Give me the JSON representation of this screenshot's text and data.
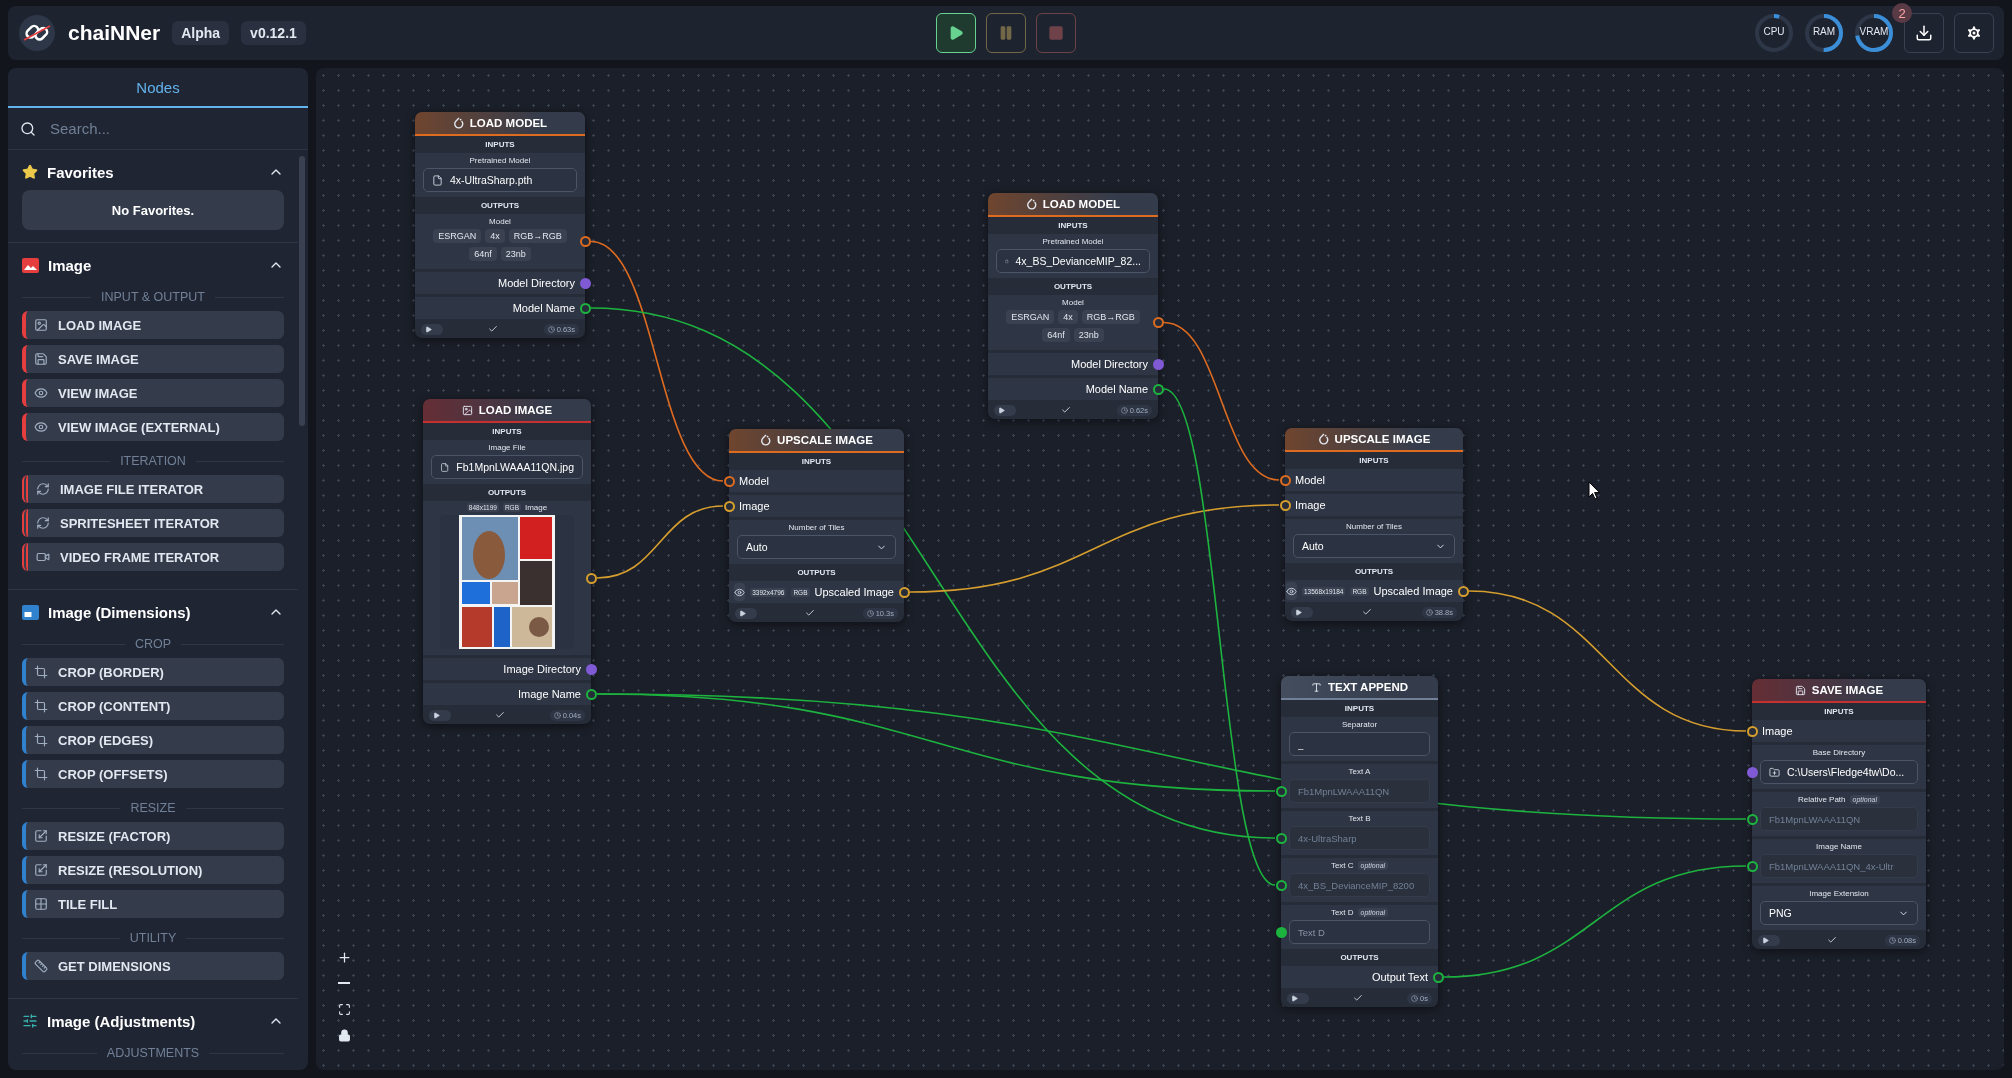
{
  "header": {
    "app_name": "chaiNNer",
    "badges": [
      "Alpha",
      "v0.12.1"
    ],
    "controls": [
      {
        "kind": "play",
        "disabled": false
      },
      {
        "kind": "pause",
        "disabled": true
      },
      {
        "kind": "stop",
        "disabled": true
      }
    ],
    "monitors": [
      {
        "label": "CPU"
      },
      {
        "label": "RAM"
      },
      {
        "label": "VRAM"
      }
    ],
    "download_count": "2"
  },
  "sidebar": {
    "tabs": [
      {
        "label": "Nodes",
        "selected": true
      }
    ],
    "search": {
      "placeholder": "Search..."
    },
    "categories": [
      {
        "name": "Favorites",
        "color": "#ecc94b",
        "expanded": true,
        "empty_text": "No Favorites."
      },
      {
        "name": "Image",
        "color": "#e53e3e",
        "expanded": true,
        "groups": [
          {
            "label": "INPUT & OUTPUT",
            "items": [
              {
                "label": "LOAD IMAGE",
                "kind": "node"
              },
              {
                "label": "SAVE IMAGE",
                "kind": "node"
              },
              {
                "label": "VIEW IMAGE",
                "kind": "node"
              },
              {
                "label": "VIEW IMAGE (EXTERNAL)",
                "kind": "node"
              }
            ]
          },
          {
            "label": "ITERATION",
            "items": [
              {
                "label": "IMAGE FILE ITERATOR",
                "kind": "iterator"
              },
              {
                "label": "SPRITESHEET ITERATOR",
                "kind": "iterator"
              },
              {
                "label": "VIDEO FRAME ITERATOR",
                "kind": "iterator"
              }
            ]
          }
        ]
      },
      {
        "name": "Image (Dimensions)",
        "color": "#3182ce",
        "expanded": true,
        "groups": [
          {
            "label": "CROP",
            "items": [
              {
                "label": "CROP (BORDER)",
                "kind": "node"
              },
              {
                "label": "CROP (CONTENT)",
                "kind": "node"
              },
              {
                "label": "CROP (EDGES)",
                "kind": "node"
              },
              {
                "label": "CROP (OFFSETS)",
                "kind": "node"
              }
            ]
          },
          {
            "label": "RESIZE",
            "items": [
              {
                "label": "RESIZE (FACTOR)",
                "kind": "node"
              },
              {
                "label": "RESIZE (RESOLUTION)",
                "kind": "node"
              },
              {
                "label": "TILE FILL",
                "kind": "node"
              }
            ]
          },
          {
            "label": "UTILITY",
            "items": [
              {
                "label": "GET DIMENSIONS",
                "kind": "node"
              }
            ]
          }
        ]
      },
      {
        "name": "Image (Adjustments)",
        "color": "#38b2ac",
        "expanded": true,
        "groups": [
          {
            "label": "ADJUSTMENTS"
          }
        ]
      }
    ]
  },
  "nodes": [
    {
      "title": "LOAD MODEL",
      "color": "#dd6b20",
      "enabled": true,
      "timing": "0.63s",
      "rows": [
        {
          "kind": "section",
          "label": "INPUTS"
        },
        {
          "kind": "file",
          "label": "Pretrained Model",
          "value": "4x-UltraSharp.pth"
        },
        {
          "kind": "section",
          "label": "OUTPUTS"
        },
        {
          "kind": "model_info",
          "label": "Model",
          "tags": [
            "ESRGAN",
            "4x",
            "RGB→RGB",
            "64nf",
            "23nb"
          ],
          "color": "#dd6b20",
          "connected": true
        },
        {
          "kind": "output",
          "label": "Model Directory",
          "color": "#805ad5",
          "connected": false
        },
        {
          "kind": "output",
          "label": "Model Name",
          "color": "#1db33f",
          "connected": true
        }
      ]
    },
    {
      "title": "LOAD IMAGE",
      "color": "#c53030",
      "enabled": true,
      "timing": "0.04s",
      "rows": [
        {
          "kind": "section",
          "label": "INPUTS"
        },
        {
          "kind": "file",
          "label": "Image File",
          "value": "Fb1MpnLWAAA11QN.jpg"
        },
        {
          "kind": "section",
          "label": "OUTPUTS"
        },
        {
          "kind": "image_preview",
          "tags": [
            "848x1199",
            "RGB"
          ],
          "label": "Image",
          "color": "#d69e2e",
          "connected": true
        },
        {
          "kind": "output",
          "label": "Image Directory",
          "color": "#805ad5",
          "connected": false
        },
        {
          "kind": "output",
          "label": "Image Name",
          "color": "#1db33f",
          "connected": true
        }
      ]
    },
    {
      "title": "UPSCALE IMAGE",
      "color": "#dd6b20",
      "enabled": true,
      "timing": "10.3s",
      "rows": [
        {
          "kind": "section",
          "label": "INPUTS"
        },
        {
          "kind": "input",
          "label": "Model",
          "color": "#dd6b20",
          "connected": true
        },
        {
          "kind": "input",
          "label": "Image",
          "color": "#d69e2e",
          "connected": true
        },
        {
          "kind": "select",
          "label": "Number of Tiles",
          "value": "Auto"
        },
        {
          "kind": "section",
          "label": "OUTPUTS"
        },
        {
          "kind": "output_image",
          "tags": [
            "3392x4796",
            "RGB"
          ],
          "label": "Upscaled Image",
          "color": "#d69e2e",
          "connected": true
        }
      ]
    },
    {
      "title": "LOAD MODEL",
      "color": "#dd6b20",
      "enabled": true,
      "timing": "0.62s",
      "rows": [
        {
          "kind": "section",
          "label": "INPUTS"
        },
        {
          "kind": "file",
          "label": "Pretrained Model",
          "value": "4x_BS_DevianceMIP_82..."
        },
        {
          "kind": "section",
          "label": "OUTPUTS"
        },
        {
          "kind": "model_info",
          "label": "Model",
          "tags": [
            "ESRGAN",
            "4x",
            "RGB→RGB",
            "64nf",
            "23nb"
          ],
          "color": "#dd6b20",
          "connected": true
        },
        {
          "kind": "output",
          "label": "Model Directory",
          "color": "#805ad5",
          "connected": false
        },
        {
          "kind": "output",
          "label": "Model Name",
          "color": "#1db33f",
          "connected": true
        }
      ]
    },
    {
      "title": "UPSCALE IMAGE",
      "color": "#dd6b20",
      "enabled": true,
      "timing": "38.8s",
      "rows": [
        {
          "kind": "section",
          "label": "INPUTS"
        },
        {
          "kind": "input",
          "label": "Model",
          "color": "#dd6b20",
          "connected": true
        },
        {
          "kind": "input",
          "label": "Image",
          "color": "#d69e2e",
          "connected": true
        },
        {
          "kind": "select",
          "label": "Number of Tiles",
          "value": "Auto"
        },
        {
          "kind": "section",
          "label": "OUTPUTS"
        },
        {
          "kind": "output_image",
          "tags": [
            "13568x19184",
            "RGB"
          ],
          "label": "Upscaled Image",
          "color": "#d69e2e",
          "connected": true
        }
      ]
    },
    {
      "title": "TEXT APPEND",
      "color": "#718096",
      "enabled": true,
      "timing": "0s",
      "rows": [
        {
          "kind": "section",
          "label": "INPUTS"
        },
        {
          "kind": "text",
          "label": "Separator",
          "value": "_",
          "disabled": false
        },
        {
          "kind": "text",
          "label": "Text A",
          "value": "Fb1MpnLWAAA11QN",
          "disabled": true,
          "color": "#1db33f",
          "connected": true
        },
        {
          "kind": "text",
          "label": "Text B",
          "value": "4x-UltraSharp",
          "disabled": true,
          "color": "#1db33f",
          "connected": true
        },
        {
          "kind": "text",
          "label": "Text C",
          "badge": "optional",
          "value": "4x_BS_DevianceMIP_8200",
          "disabled": true,
          "color": "#1db33f",
          "connected": true
        },
        {
          "kind": "text",
          "label": "Text D",
          "badge": "optional",
          "placeholder": "Text D",
          "disabled": false,
          "color": "#1db33f",
          "connected": false
        },
        {
          "kind": "section",
          "label": "OUTPUTS"
        },
        {
          "kind": "output",
          "label": "Output Text",
          "color": "#1db33f",
          "connected": true
        }
      ]
    },
    {
      "title": "SAVE IMAGE",
      "color": "#c53030",
      "enabled": true,
      "timing": "0.08s",
      "rows": [
        {
          "kind": "section",
          "label": "INPUTS"
        },
        {
          "kind": "input",
          "label": "Image",
          "color": "#d69e2e",
          "connected": true
        },
        {
          "kind": "directory",
          "label": "Base Directory",
          "value": "C:\\Users\\Fledge4tw\\Do...",
          "color": "#805ad5",
          "connected": false
        },
        {
          "kind": "text",
          "label": "Relative Path",
          "badge": "optional",
          "value": "Fb1MpnLWAAA11QN",
          "disabled": true,
          "color": "#1db33f",
          "connected": true
        },
        {
          "kind": "text",
          "label": "Image Name",
          "value": "Fb1MpnLWAAA11QN_4x-Ultr",
          "disabled": true,
          "color": "#1db33f",
          "connected": true
        },
        {
          "kind": "select",
          "label": "Image Extension",
          "value": "PNG"
        }
      ]
    }
  ]
}
